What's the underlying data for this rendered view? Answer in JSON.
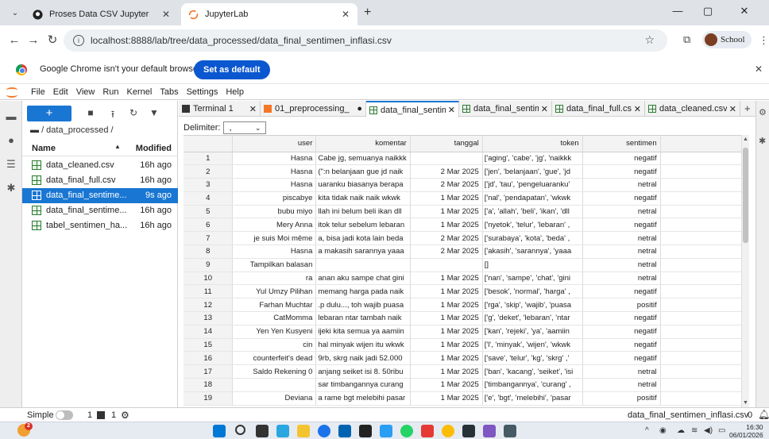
{
  "browser": {
    "tabs": [
      {
        "title": "Proses Data CSV Jupyter",
        "active": false
      },
      {
        "title": "JupyterLab",
        "active": true
      }
    ],
    "url": "localhost:8888/lab/tree/data_processed/data_final_sentimen_inflasi.csv",
    "profile": "School",
    "infobar_message": "Google Chrome isn't your default browser",
    "set_default_label": "Set as default"
  },
  "jupyter": {
    "menu": [
      "File",
      "Edit",
      "View",
      "Run",
      "Kernel",
      "Tabs",
      "Settings",
      "Help"
    ],
    "filebrowser": {
      "path": "/ data_processed /",
      "col_name": "Name",
      "col_modified": "Modified",
      "files": [
        {
          "name": "data_cleaned.csv",
          "modified": "16h ago"
        },
        {
          "name": "data_final_full.csv",
          "modified": "16h ago"
        },
        {
          "name": "data_final_sentime...",
          "modified": "9s ago"
        },
        {
          "name": "data_final_sentime...",
          "modified": "16h ago"
        },
        {
          "name": "tabel_sentimen_ha...",
          "modified": "16h ago"
        }
      ]
    },
    "doc_tabs": [
      {
        "label": "Terminal 1"
      },
      {
        "label": "01_preprocessing_"
      },
      {
        "label": "data_final_sentime"
      },
      {
        "label": "data_final_sentime"
      },
      {
        "label": "data_final_full.csv"
      },
      {
        "label": "data_cleaned.csv"
      }
    ],
    "delimiter_label": "Delimiter:",
    "delimiter_value": ",",
    "table": {
      "columns": [
        "user",
        "komentar",
        "tanggal",
        "token",
        "sentimen"
      ],
      "rows": [
        [
          "1",
          "Hasna",
          "Cabe jg, semuanya naikkk",
          "",
          "aging', 'cabe', 'jg', 'naikkk']",
          "negatif"
        ],
        [
          "2",
          "Hasna",
          "n belanjaan gue jd naik:\")",
          "2 Mar 2025",
          "jen', 'belanjaan', 'gue', 'jd']",
          "negatif"
        ],
        [
          "3",
          "Hasna",
          "uaranku biasanya berapa",
          "2 Mar 2025",
          "'jd', 'tau', 'pengeluaranku']",
          "netral"
        ],
        [
          "4",
          "piscabye",
          "kita tidak naik naik wkwk",
          "1 Mar 2025",
          "nal', 'pendapatan', 'wkwk']",
          "negatif"
        ],
        [
          "5",
          "bubu miyo",
          "llah ini belum beli ikan dll",
          "1 Mar 2025",
          "a', 'allah', 'beli', 'ikan', 'dll']",
          "netral"
        ],
        [
          "6",
          "Mery Anna",
          "itok telur sebelum lebaran",
          "1 Mar 2025",
          ", 'nyetok', 'telur', 'lebaran']",
          "negatif"
        ],
        [
          "7",
          "je suis Moi même",
          "a, bisa jadi kota lain beda",
          "2 Mar 2025",
          ", 'surabaya', 'kota', 'beda']",
          "netral"
        ],
        [
          "8",
          "Hasna",
          "a makasih sarannya yaaa",
          "2 Mar 2025",
          "akasih', 'sarannya', 'yaaa']",
          "netral"
        ],
        [
          "9",
          "Tampilkan balasan",
          "",
          "",
          "[]",
          "netral"
        ],
        [
          "10",
          "ra",
          "anan aku sampe chat gini",
          "1 Mar 2025",
          "nan', 'sampe', 'chat', 'gini']",
          "netral"
        ],
        [
          "11",
          "Yul Umzy Pilihan",
          "memang harga pada naik",
          "1 Mar 2025",
          ", 'besok', 'normal', 'harga']",
          "negatif"
        ],
        [
          "12",
          "Farhan Muchtar",
          "p dulu..., toh wajib puasa.",
          "1 Mar 2025",
          "rga', 'skip', 'wajib', 'puasa']",
          "positif"
        ],
        [
          "13",
          "CatMomma",
          "lebaran ntar tambah naik",
          "1 Mar 2025",
          "g', 'deket', 'lebaran', 'ntar']",
          "negatif"
        ],
        [
          "14",
          "Yen Yen Kusyeni",
          "ijeki kita semua ya aamiin",
          "1 Mar 2025",
          "kan', 'rejeki', 'ya', 'aamiin']",
          "negatif"
        ],
        [
          "15",
          "cin",
          "hal minyak wijen itu wkwk",
          "1 Mar 2025",
          "l', 'minyak', 'wijen', 'wkwk']",
          "negatif"
        ],
        [
          "16",
          "counterfeit's dead",
          "9rb, skrg naik jadi 52.000",
          "1 Mar 2025",
          "', 'save', 'telur', 'kg', 'skrg']",
          "negatif"
        ],
        [
          "17",
          "Saldo Rekening 0",
          "anjang seiket isi 8. 50ribu",
          "1 Mar 2025",
          "ban', 'kacang', 'seiket', 'isi']",
          "netral"
        ],
        [
          "18",
          "",
          "sar timbangannya curang",
          "1 Mar 2025",
          ", 'timbangannya', 'curang']",
          "netral"
        ],
        [
          "19",
          "Deviana",
          "a rame bgt melebihi pasar",
          "1 Mar 2025",
          "e', 'bgt', 'melebihi', 'pasar']",
          "positif"
        ]
      ]
    },
    "status": {
      "simple_label": "Simple",
      "terminals": "1",
      "kernels": "1",
      "filename": "data_final_sentimen_inflasi.csv",
      "count": "0"
    }
  },
  "taskbar": {
    "notification_badge": "2",
    "time": "16:30",
    "date": "06/01/2026"
  },
  "colors": {
    "accent": "#1976d2",
    "chrome_blue": "#0b57d0",
    "jupyter_orange": "#f37726"
  }
}
